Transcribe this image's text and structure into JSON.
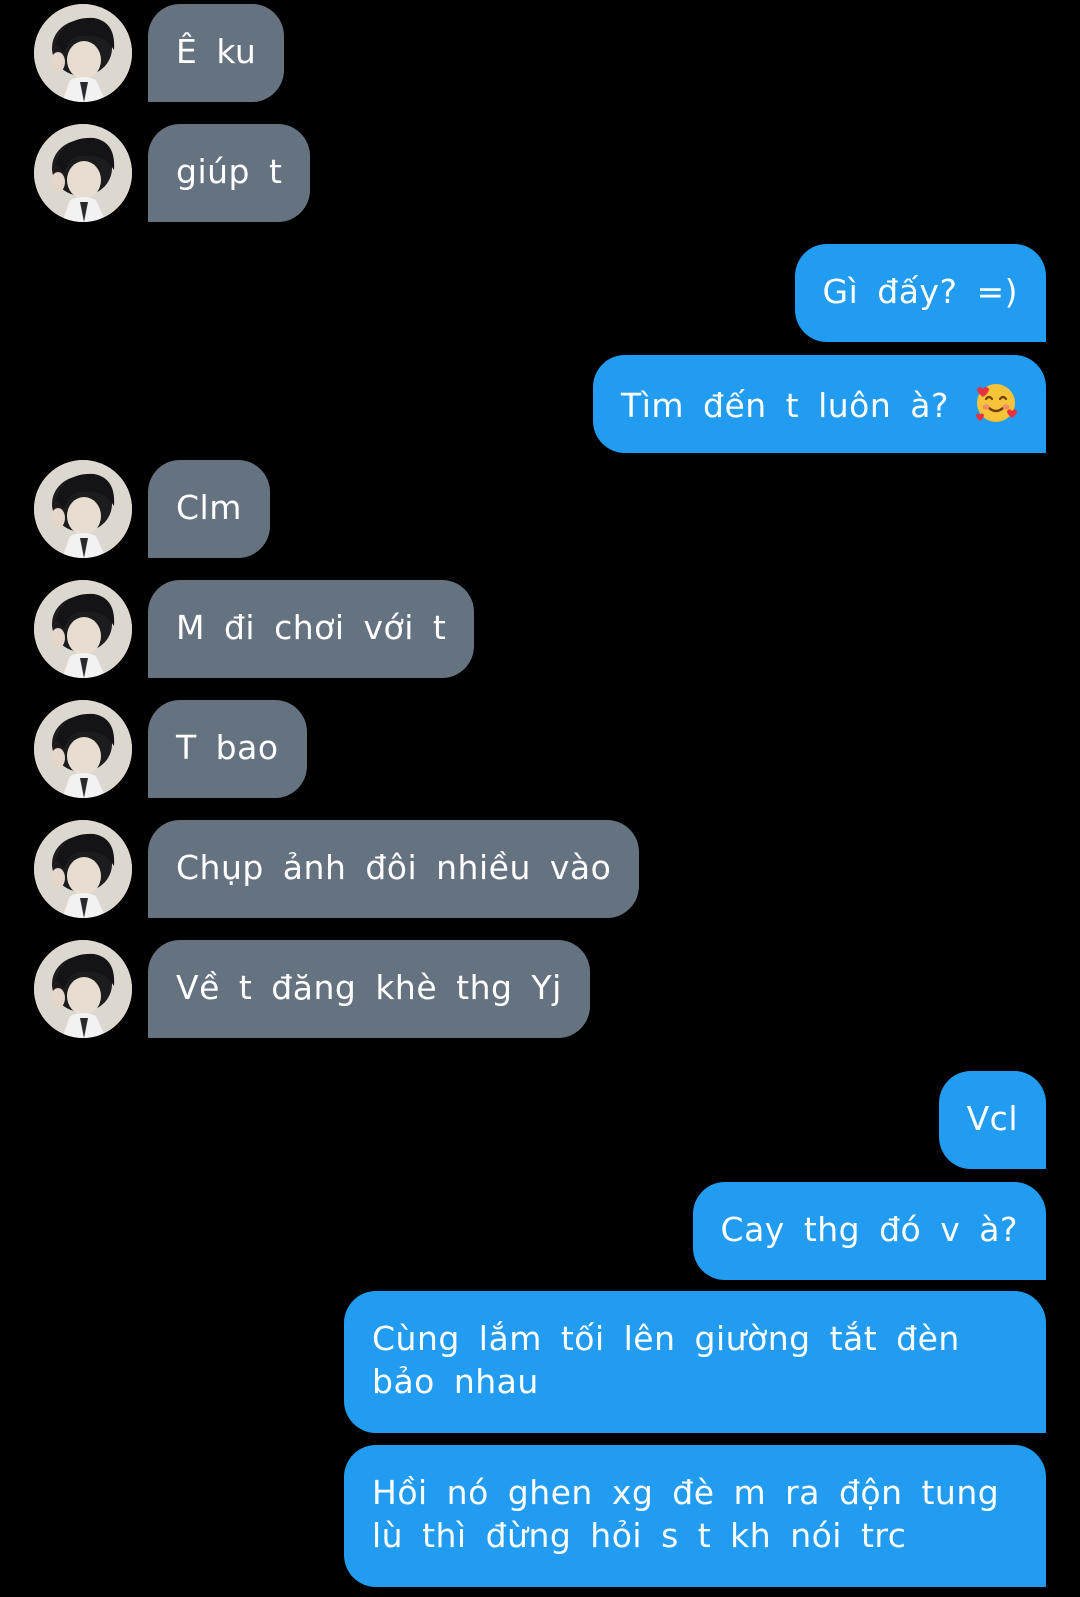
{
  "conversation": {
    "messages": [
      {
        "side": "in",
        "text": "Ê ku"
      },
      {
        "side": "in",
        "text": "giúp t"
      },
      {
        "side": "out",
        "text": "Gì đấy? =)"
      },
      {
        "side": "out",
        "text": "Tìm đến t luôn à?",
        "emoji": "smiling-face-with-hearts-icon"
      },
      {
        "side": "in",
        "text": "Clm"
      },
      {
        "side": "in",
        "text": "M đi chơi với t"
      },
      {
        "side": "in",
        "text": "T bao"
      },
      {
        "side": "in",
        "text": "Chụp ảnh đôi nhiều vào"
      },
      {
        "side": "in",
        "text": "Về t đăng khè thg Yj"
      },
      {
        "side": "out",
        "text": "Vcl"
      },
      {
        "side": "out",
        "text": "Cay thg đó v à?"
      },
      {
        "side": "out",
        "text": "Cùng lắm tối lên giường tắt đèn bảo nhau"
      },
      {
        "side": "out",
        "text": "Hồi nó ghen xg đè m ra độn tung lù thì đừng hỏi s t kh nói trc"
      }
    ]
  },
  "colors": {
    "background": "#000000",
    "incoming_bubble": "#657280",
    "outgoing_bubble": "#229cf0",
    "text": "#ffffff"
  }
}
